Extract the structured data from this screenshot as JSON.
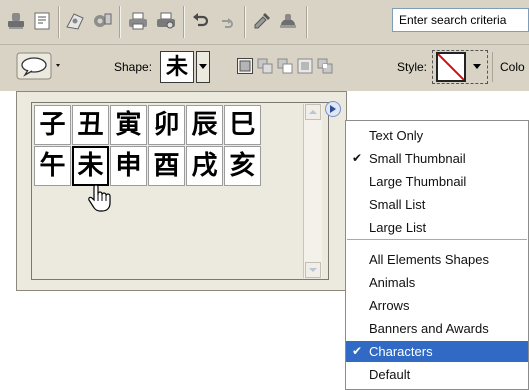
{
  "toolbar": {
    "search_placeholder": "Enter search criteria",
    "icons": [
      "stamp-icon",
      "jpeg-icon",
      "photo-paper-icon",
      "photo-print-icon",
      "printer-icon",
      "printer-preview-icon",
      "undo-icon",
      "redo-icon",
      "eyedropper-icon",
      "clone-stamp-icon"
    ]
  },
  "options": {
    "shape_label": "Shape:",
    "shape_char": "未",
    "style_label": "Style:",
    "color_label": "Colo"
  },
  "panel": {
    "cells": [
      "子",
      "丑",
      "寅",
      "卯",
      "辰",
      "巳",
      "午",
      "未",
      "申",
      "酉",
      "戌",
      "亥"
    ],
    "selected_index": 7
  },
  "menu": {
    "view_items": [
      {
        "label": "Text Only",
        "checked": false
      },
      {
        "label": "Small Thumbnail",
        "checked": true
      },
      {
        "label": "Large Thumbnail",
        "checked": false
      },
      {
        "label": "Small List",
        "checked": false
      },
      {
        "label": "Large List",
        "checked": false
      }
    ],
    "library_items": [
      {
        "label": "All Elements Shapes",
        "checked": false
      },
      {
        "label": "Animals",
        "checked": false
      },
      {
        "label": "Arrows",
        "checked": false
      },
      {
        "label": "Banners and Awards",
        "checked": false
      },
      {
        "label": "Characters",
        "checked": true,
        "highlighted": true
      },
      {
        "label": "Default",
        "checked": false
      }
    ],
    "check_glyph": "✔",
    "highlight_color": "#316ac5"
  }
}
